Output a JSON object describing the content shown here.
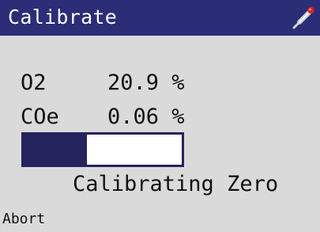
{
  "header": {
    "title": "Calibrate",
    "icon": "probe-icon",
    "background_color": "#2b2d77"
  },
  "readings": [
    {
      "label": "O2",
      "value": "20.9 %"
    },
    {
      "label": "COe",
      "value": "0.06 %"
    }
  ],
  "progress": {
    "fraction": 0.4,
    "fill_color": "#25235e"
  },
  "status": "Calibrating Zero",
  "softkey": {
    "abort_label": "Abort"
  }
}
